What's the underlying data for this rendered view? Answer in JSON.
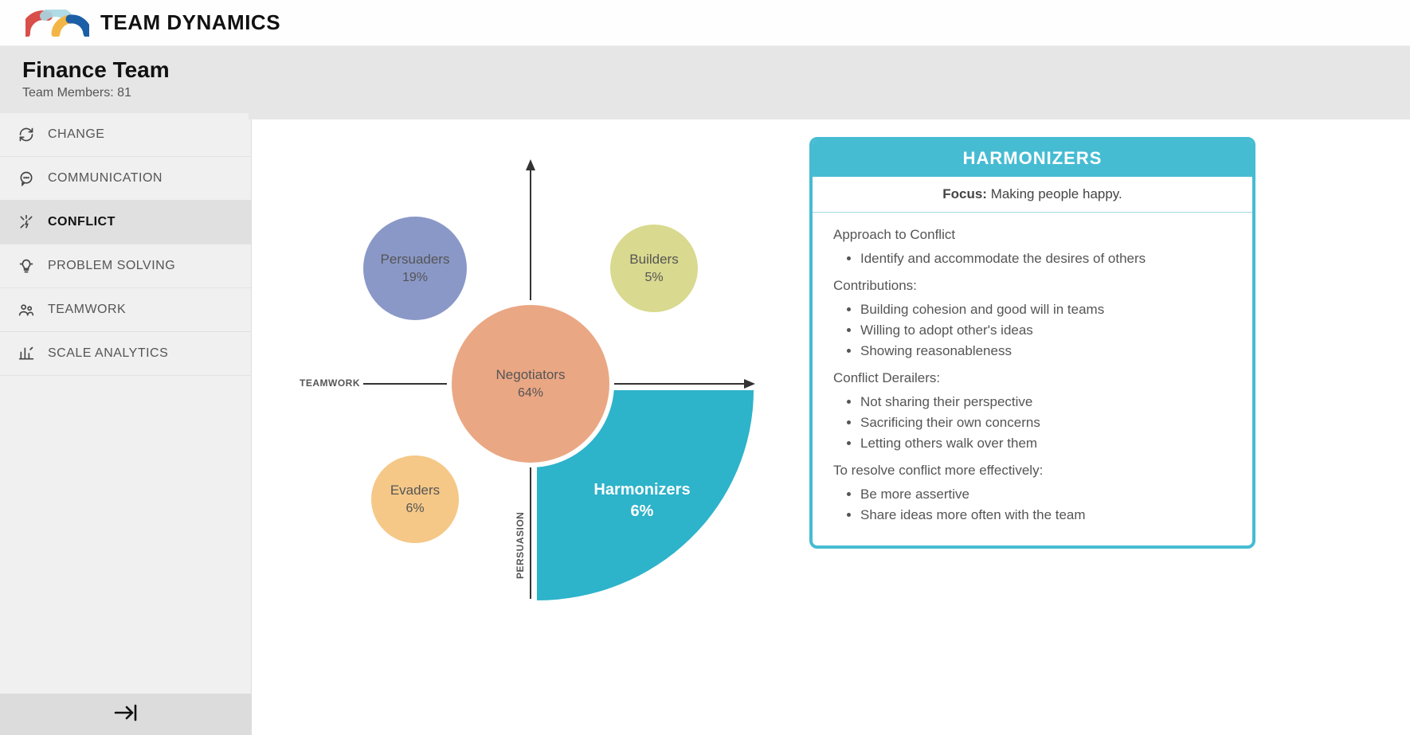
{
  "brand": {
    "title": "TEAM DYNAMICS"
  },
  "team": {
    "name": "Finance Team",
    "members_label": "Team Members:",
    "members_count": "81"
  },
  "sidebar": {
    "items": [
      {
        "id": "change",
        "label": "CHANGE",
        "icon": "refresh-icon",
        "active": false
      },
      {
        "id": "communication",
        "label": "COMMUNICATION",
        "icon": "chat-icon",
        "active": false
      },
      {
        "id": "conflict",
        "label": "CONFLICT",
        "icon": "spark-icon",
        "active": true
      },
      {
        "id": "problem-solving",
        "label": "PROBLEM SOLVING",
        "icon": "lightbulb-icon",
        "active": false
      },
      {
        "id": "teamwork",
        "label": "TEAMWORK",
        "icon": "people-icon",
        "active": false
      },
      {
        "id": "scale-analytics",
        "label": "SCALE ANALYTICS",
        "icon": "barchart-icon",
        "active": false
      }
    ],
    "collapse_tooltip": "Collapse sidebar"
  },
  "chart_data": {
    "type": "bubble-quadrant",
    "axes": {
      "x_left": "TEAMWORK",
      "y_bottom": "PERSUASION"
    },
    "selected": "Harmonizers",
    "series": [
      {
        "name": "Persuaders",
        "pct": "19%",
        "value": 19,
        "color": "#8a98c8",
        "quadrant": "top-left"
      },
      {
        "name": "Builders",
        "pct": "5%",
        "value": 5,
        "color": "#d7d88b",
        "quadrant": "top-right"
      },
      {
        "name": "Negotiators",
        "pct": "64%",
        "value": 64,
        "color": "#e8a07a",
        "quadrant": "center"
      },
      {
        "name": "Evaders",
        "pct": "6%",
        "value": 6,
        "color": "#f4c37c",
        "quadrant": "bottom-left"
      },
      {
        "name": "Harmonizers",
        "pct": "6%",
        "value": 6,
        "color": "#2db3ca",
        "quadrant": "bottom-right"
      }
    ]
  },
  "panel": {
    "title": "HARMONIZERS",
    "focus_label": "Focus:",
    "focus_text": "Making people happy.",
    "sections": [
      {
        "title": "Approach to Conflict",
        "items": [
          "Identify and accommodate the desires of others"
        ]
      },
      {
        "title": "Contributions:",
        "items": [
          "Building cohesion and good will in teams",
          "Willing to adopt other's ideas",
          "Showing reasonableness"
        ]
      },
      {
        "title": "Conflict Derailers:",
        "items": [
          "Not sharing their perspective",
          "Sacrificing their own concerns",
          "Letting others walk over them"
        ]
      },
      {
        "title": "To resolve conflict more effectively:",
        "items": [
          "Be more assertive",
          "Share ideas more often with the team"
        ]
      }
    ]
  }
}
